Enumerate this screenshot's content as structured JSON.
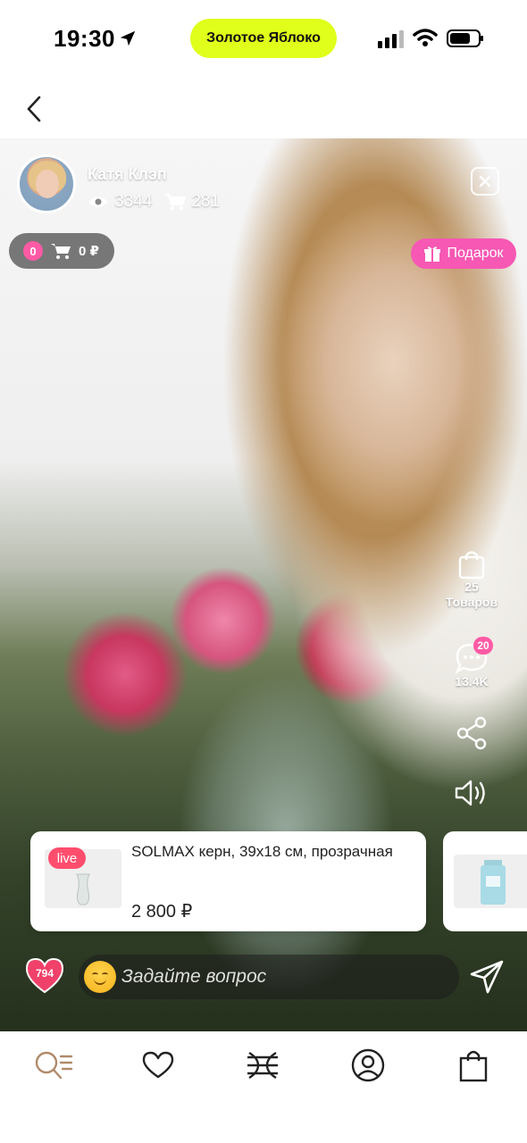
{
  "status_bar": {
    "time": "19:30",
    "carrier_pill": "Золотое Яблоко",
    "icons": [
      "location-arrow-icon",
      "cellular-signal-icon",
      "wifi-icon",
      "battery-icon"
    ]
  },
  "header": {
    "back_icon": "chevron-left-icon"
  },
  "stream": {
    "streamer_name": "Катя Клэп",
    "views": "3344",
    "purchases": "281",
    "close_icon": "close-icon",
    "cart": {
      "count": "0",
      "total": "0 ₽"
    },
    "gift_label": "Подарок",
    "side_actions": {
      "products_count": "25",
      "products_label": "Товаров",
      "chat_badge": "20",
      "chat_count": "13.4K"
    },
    "product_card": {
      "live_label": "live",
      "title": "SOLMAX керн, 39x18 см, прозрачная",
      "price": "2 800 ₽"
    },
    "likes": "794",
    "question_placeholder": "Задайте вопрос"
  },
  "bottom_nav": {
    "items": [
      "search-menu-icon",
      "heart-icon",
      "catalog-logo-icon",
      "profile-icon",
      "bag-icon"
    ]
  },
  "colors": {
    "accent_yellow": "#e0ff1a",
    "accent_pink": "#f658b3",
    "live_red": "#ff4d6d",
    "search_icon_tint": "#b08a6a"
  }
}
